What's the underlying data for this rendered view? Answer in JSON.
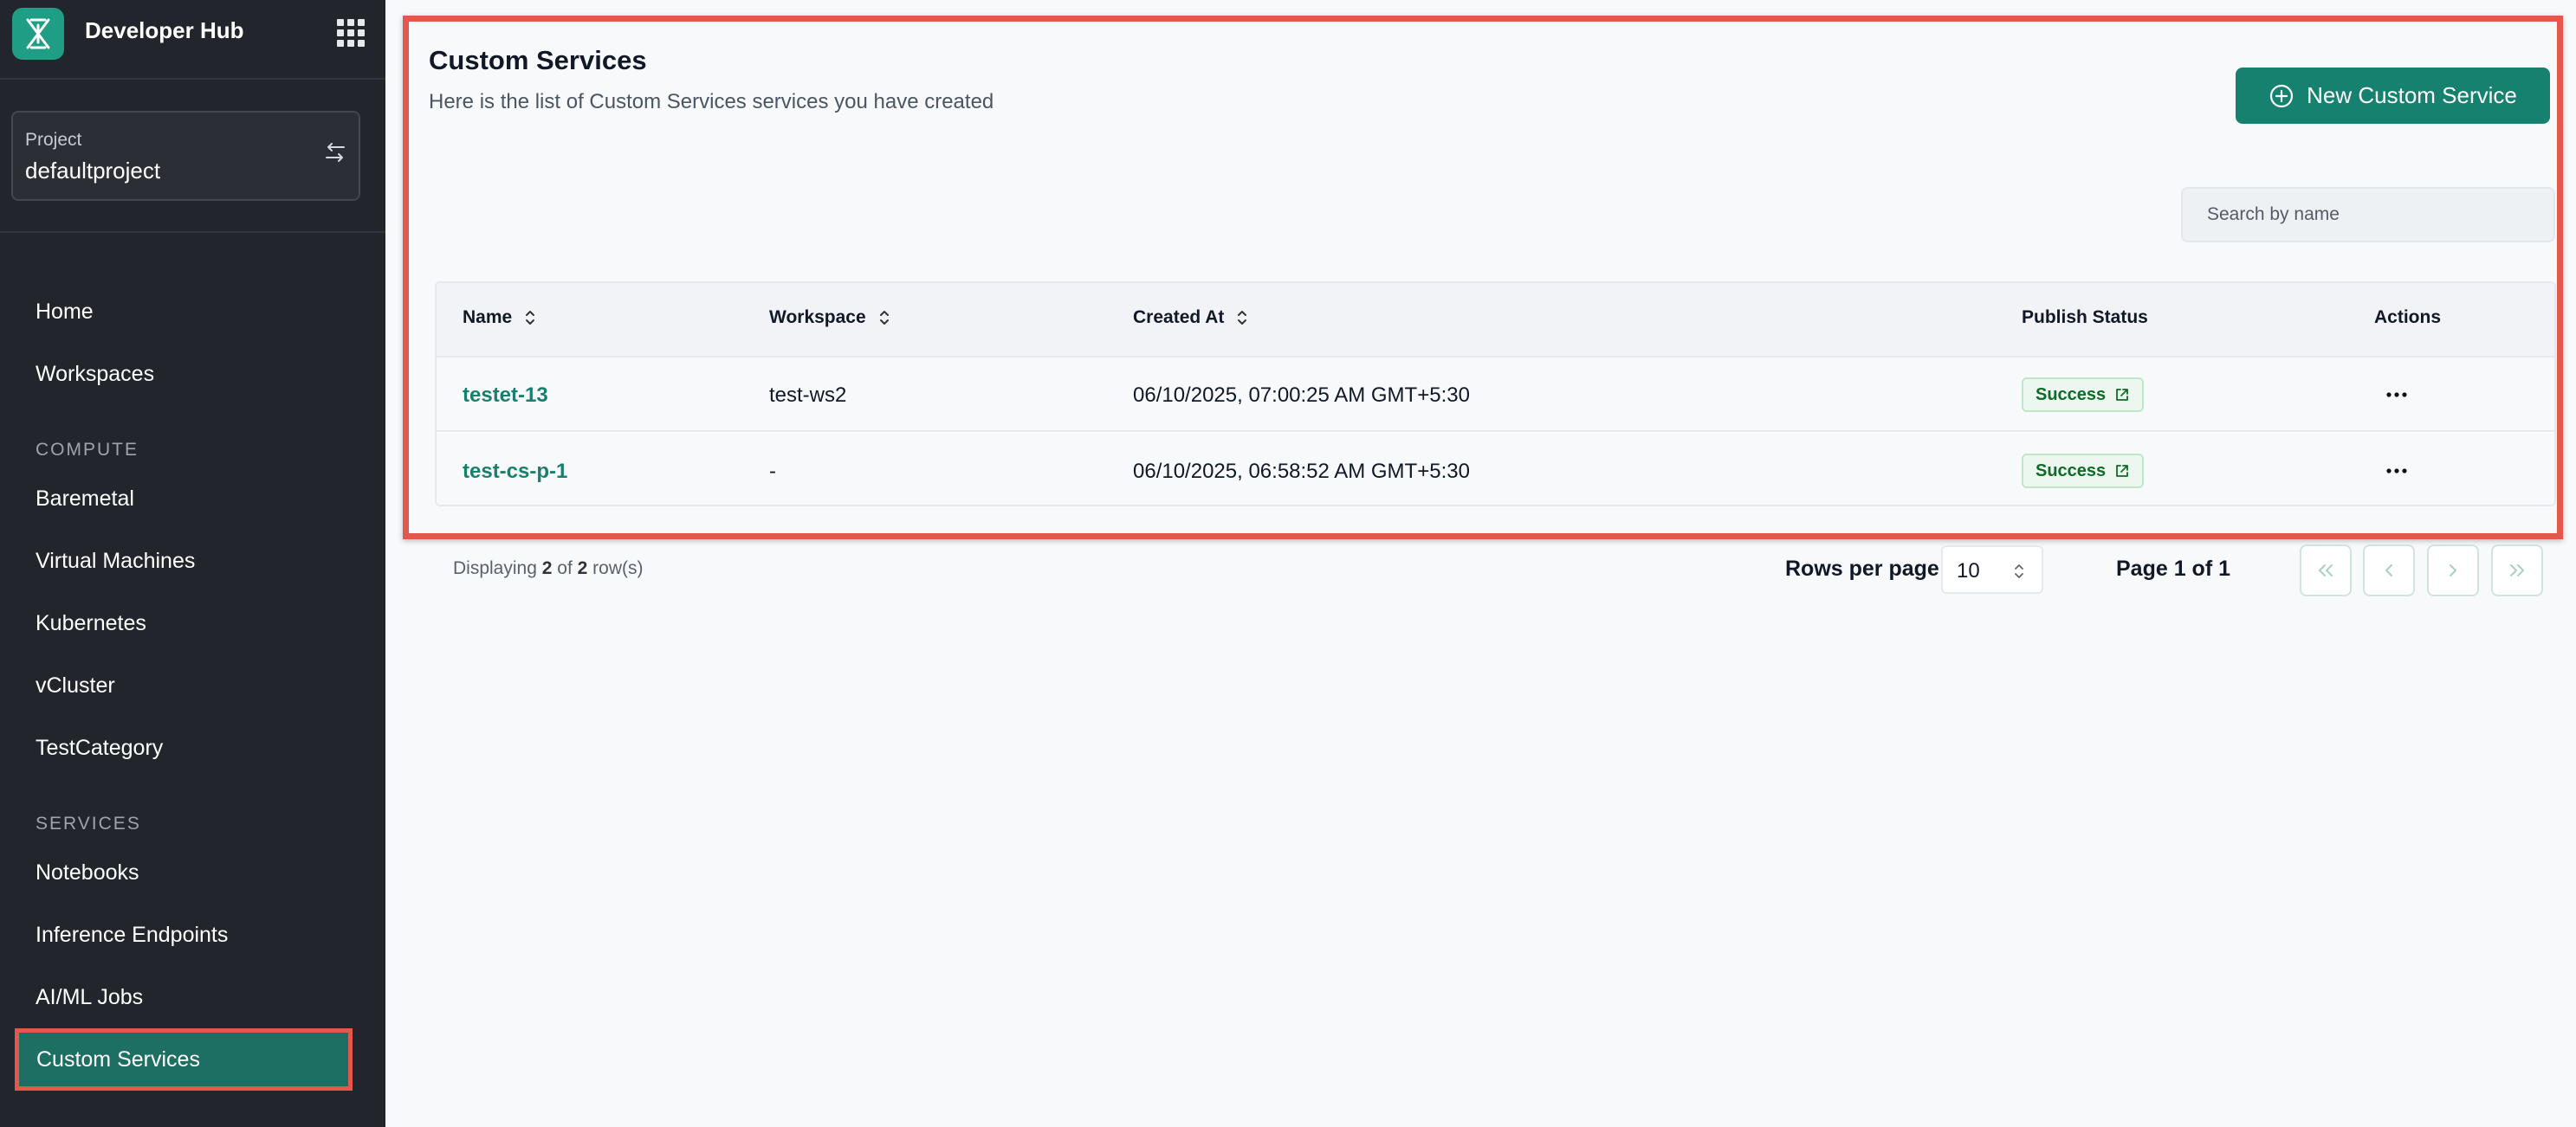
{
  "app": {
    "name": "Developer Hub"
  },
  "project": {
    "label": "Project",
    "name": "defaultproject"
  },
  "sidebar": {
    "top_items": [
      {
        "label": "Home"
      },
      {
        "label": "Workspaces"
      }
    ],
    "compute": {
      "title": "COMPUTE",
      "items": [
        {
          "label": "Baremetal"
        },
        {
          "label": "Virtual Machines"
        },
        {
          "label": "Kubernetes"
        },
        {
          "label": "vCluster"
        },
        {
          "label": "TestCategory"
        }
      ]
    },
    "services": {
      "title": "SERVICES",
      "items": [
        {
          "label": "Notebooks"
        },
        {
          "label": "Inference Endpoints"
        },
        {
          "label": "AI/ML Jobs"
        },
        {
          "label": "Custom Services"
        }
      ]
    }
  },
  "page": {
    "title": "Custom Services",
    "subtitle": "Here is the list of Custom Services services you have created",
    "new_button": "New Custom Service",
    "search_placeholder": "Search by name"
  },
  "table": {
    "columns": [
      "Name",
      "Workspace",
      "Created At",
      "Publish Status",
      "Actions"
    ],
    "rows": [
      {
        "name": "testet-13",
        "workspace": "test-ws2",
        "created_at": "06/10/2025, 07:00:25 AM GMT+5:30",
        "status": "Success"
      },
      {
        "name": "test-cs-p-1",
        "workspace": "-",
        "created_at": "06/10/2025, 06:58:52 AM GMT+5:30",
        "status": "Success"
      }
    ]
  },
  "pagination": {
    "displaying_prefix": "Displaying",
    "shown": "2",
    "of": "of",
    "total": "2",
    "suffix": "row(s)",
    "rows_per_page_label": "Rows per page",
    "rows_per_page": "10",
    "page_info": "Page 1 of 1"
  },
  "colors": {
    "accent": "#178170",
    "sidebar_bg": "#22252c",
    "highlight": "#e4574a",
    "success_text": "#0f6b27"
  },
  "icons": [
    "logo-icon",
    "apps-grid-icon",
    "swap-icon",
    "sort-icon",
    "plus-circle-icon",
    "external-link-icon",
    "more-horizontal-icon",
    "chevrons-left-icon",
    "chevron-left-icon",
    "chevron-right-icon",
    "chevrons-right-icon"
  ]
}
